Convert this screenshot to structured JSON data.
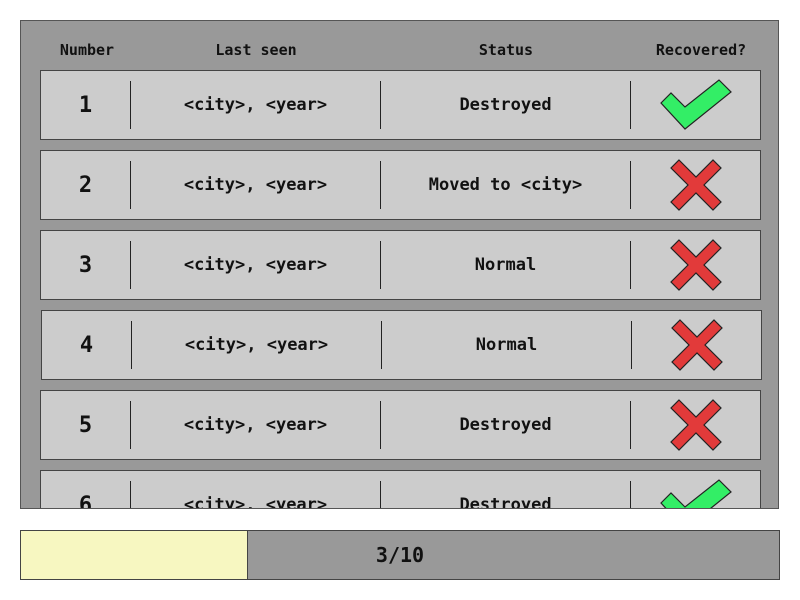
{
  "table": {
    "headers": {
      "number": "Number",
      "last_seen": "Last seen",
      "status": "Status",
      "recovered": "Recovered?"
    },
    "rows": [
      {
        "number": "1",
        "last_seen": "<city>, <year>",
        "status": "Destroyed",
        "recovered": "check-icon"
      },
      {
        "number": "2",
        "last_seen": "<city>, <year>",
        "status": "Moved to <city>",
        "recovered": "cross-icon"
      },
      {
        "number": "3",
        "last_seen": "<city>, <year>",
        "status": "Normal",
        "recovered": "cross-icon"
      },
      {
        "number": "4",
        "last_seen": "<city>, <year>",
        "status": "Normal",
        "recovered": "cross-icon"
      },
      {
        "number": "5",
        "last_seen": "<city>, <year>",
        "status": "Destroyed",
        "recovered": "cross-icon"
      },
      {
        "number": "6",
        "last_seen": "<city>, <year>",
        "status": "Destroyed",
        "recovered": "check-icon"
      }
    ]
  },
  "progress": {
    "label": "3/10",
    "value": 3,
    "max": 10
  },
  "colors": {
    "panel": "#999999",
    "row": "#cccccc",
    "check": "#33ee66",
    "cross": "#e23a3a",
    "progress_fill": "#f7f7c1"
  }
}
